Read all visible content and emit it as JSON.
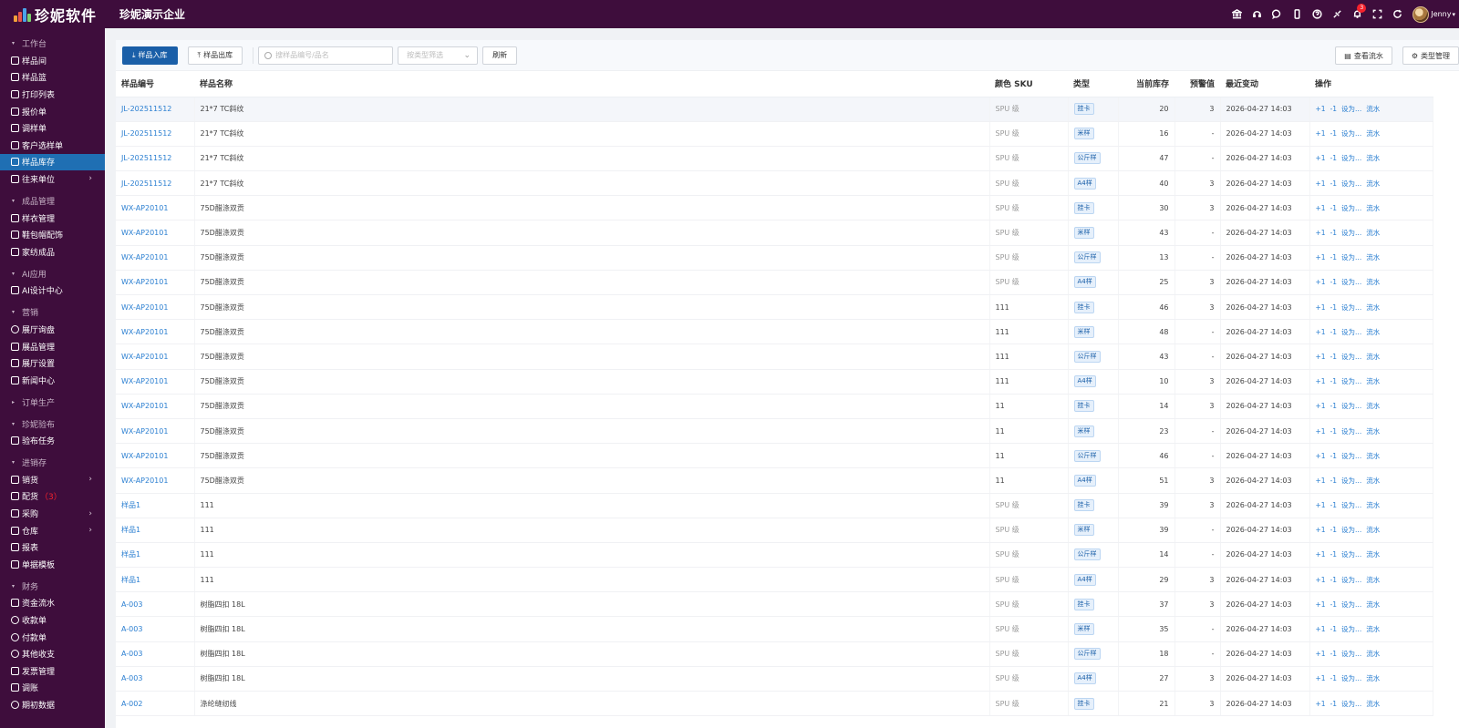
{
  "app": {
    "logo_text": "珍妮软件",
    "company": "珍妮演示企业",
    "user_name": "Jenny",
    "notify_count": "3",
    "colors": {
      "brand": "#3e0d3c",
      "primary": "#1a5fa8",
      "active": "#1f6fb3",
      "link": "#2b7fd1",
      "badge": "#f5222d"
    }
  },
  "top_icons": [
    "bank-icon",
    "headset-icon",
    "chat-icon",
    "phone-icon",
    "help-icon",
    "link-icon",
    "bell-icon",
    "fullscreen-icon",
    "refresh-icon"
  ],
  "sidebar": {
    "groups": [
      {
        "title": "工作台",
        "items": [
          {
            "label": "样品间",
            "icon": "home-icon"
          },
          {
            "label": "样品篮",
            "icon": "basket-icon"
          },
          {
            "label": "打印列表",
            "icon": "printer-icon"
          },
          {
            "label": "报价单",
            "icon": "quote-icon"
          },
          {
            "label": "调样单",
            "icon": "truck-icon"
          },
          {
            "label": "客户选样单",
            "icon": "cart-icon"
          },
          {
            "label": "样品库存",
            "icon": "inventory-icon",
            "active": true
          },
          {
            "label": "往来单位",
            "icon": "users-icon",
            "arrow": true
          }
        ]
      },
      {
        "title": "成品管理",
        "items": [
          {
            "label": "样衣管理",
            "icon": "shirt-icon"
          },
          {
            "label": "鞋包帽配饰",
            "icon": "bag-icon"
          },
          {
            "label": "家纺成品",
            "icon": "home-icon"
          }
        ]
      },
      {
        "title": "AI应用",
        "items": [
          {
            "label": "AI设计中心",
            "icon": "ai-icon"
          }
        ]
      },
      {
        "title": "营销",
        "items": [
          {
            "label": "展厅询盘",
            "icon": "chat-icon"
          },
          {
            "label": "展品管理",
            "icon": "image-icon"
          },
          {
            "label": "展厅设置",
            "icon": "settings-icon"
          },
          {
            "label": "新闻中心",
            "icon": "news-icon"
          }
        ]
      },
      {
        "title": "订单生产",
        "collapsed": true,
        "items": []
      },
      {
        "title": "珍妮验布",
        "items": [
          {
            "label": "验布任务",
            "icon": "task-icon"
          }
        ]
      },
      {
        "title": "进销存",
        "items": [
          {
            "label": "销货",
            "icon": "doc-icon",
            "arrow": true
          },
          {
            "label": "配货",
            "icon": "doc-icon",
            "badge": "（3）"
          },
          {
            "label": "采购",
            "icon": "cart-icon",
            "arrow": true
          },
          {
            "label": "仓库",
            "icon": "warehouse-icon",
            "arrow": true
          },
          {
            "label": "报表",
            "icon": "table-icon"
          },
          {
            "label": "单据模板",
            "icon": "template-icon"
          }
        ]
      },
      {
        "title": "财务",
        "items": [
          {
            "label": "资金流水",
            "icon": "money-icon"
          },
          {
            "label": "收款单",
            "icon": "coin-icon"
          },
          {
            "label": "付款单",
            "icon": "coin-icon"
          },
          {
            "label": "其他收支",
            "icon": "coin-icon"
          },
          {
            "label": "发票管理",
            "icon": "invoice-icon"
          },
          {
            "label": "调账",
            "icon": "balance-icon"
          },
          {
            "label": "期初数据",
            "icon": "clock-icon"
          }
        ]
      }
    ]
  },
  "toolbar": {
    "inbound_label": "样品入库",
    "outbound_label": "样品出库",
    "search_placeholder": "搜样品编号/品名",
    "type_filter_placeholder": "按类型筛选",
    "refresh_label": "刷新",
    "view_flow_label": "查看流水",
    "type_manage_label": "类型管理"
  },
  "table": {
    "columns": [
      "样品编号",
      "样品名称",
      "颜色 SKU",
      "类型",
      "当前库存",
      "预警值",
      "最近变动",
      "操作"
    ],
    "ops": [
      "+1",
      "-1",
      "设为...",
      "流水"
    ],
    "rows": [
      {
        "code": "JL-202511512",
        "name": "21*7 TC斜纹",
        "sku": "SPU 级",
        "type": "挂卡",
        "stock": "20",
        "warn": "3",
        "time": "2026-04-27 14:03"
      },
      {
        "code": "JL-202511512",
        "name": "21*7 TC斜纹",
        "sku": "SPU 级",
        "type": "米样",
        "stock": "16",
        "warn": "-",
        "time": "2026-04-27 14:03"
      },
      {
        "code": "JL-202511512",
        "name": "21*7 TC斜纹",
        "sku": "SPU 级",
        "type": "公斤样",
        "stock": "47",
        "warn": "-",
        "time": "2026-04-27 14:03"
      },
      {
        "code": "JL-202511512",
        "name": "21*7 TC斜纹",
        "sku": "SPU 级",
        "type": "A4样",
        "stock": "40",
        "warn": "3",
        "time": "2026-04-27 14:03"
      },
      {
        "code": "WX-AP20101",
        "name": "75D醋涤双贡",
        "sku": "SPU 级",
        "type": "挂卡",
        "stock": "30",
        "warn": "3",
        "time": "2026-04-27 14:03"
      },
      {
        "code": "WX-AP20101",
        "name": "75D醋涤双贡",
        "sku": "SPU 级",
        "type": "米样",
        "stock": "43",
        "warn": "-",
        "time": "2026-04-27 14:03"
      },
      {
        "code": "WX-AP20101",
        "name": "75D醋涤双贡",
        "sku": "SPU 级",
        "type": "公斤样",
        "stock": "13",
        "warn": "-",
        "time": "2026-04-27 14:03"
      },
      {
        "code": "WX-AP20101",
        "name": "75D醋涤双贡",
        "sku": "SPU 级",
        "type": "A4样",
        "stock": "25",
        "warn": "3",
        "time": "2026-04-27 14:03"
      },
      {
        "code": "WX-AP20101",
        "name": "75D醋涤双贡",
        "sku": "111",
        "type": "挂卡",
        "stock": "46",
        "warn": "3",
        "time": "2026-04-27 14:03"
      },
      {
        "code": "WX-AP20101",
        "name": "75D醋涤双贡",
        "sku": "111",
        "type": "米样",
        "stock": "48",
        "warn": "-",
        "time": "2026-04-27 14:03"
      },
      {
        "code": "WX-AP20101",
        "name": "75D醋涤双贡",
        "sku": "111",
        "type": "公斤样",
        "stock": "43",
        "warn": "-",
        "time": "2026-04-27 14:03"
      },
      {
        "code": "WX-AP20101",
        "name": "75D醋涤双贡",
        "sku": "111",
        "type": "A4样",
        "stock": "10",
        "warn": "3",
        "time": "2026-04-27 14:03"
      },
      {
        "code": "WX-AP20101",
        "name": "75D醋涤双贡",
        "sku": "11",
        "type": "挂卡",
        "stock": "14",
        "warn": "3",
        "time": "2026-04-27 14:03"
      },
      {
        "code": "WX-AP20101",
        "name": "75D醋涤双贡",
        "sku": "11",
        "type": "米样",
        "stock": "23",
        "warn": "-",
        "time": "2026-04-27 14:03"
      },
      {
        "code": "WX-AP20101",
        "name": "75D醋涤双贡",
        "sku": "11",
        "type": "公斤样",
        "stock": "46",
        "warn": "-",
        "time": "2026-04-27 14:03"
      },
      {
        "code": "WX-AP20101",
        "name": "75D醋涤双贡",
        "sku": "11",
        "type": "A4样",
        "stock": "51",
        "warn": "3",
        "time": "2026-04-27 14:03"
      },
      {
        "code": "样品1",
        "name": "111",
        "sku": "SPU 级",
        "type": "挂卡",
        "stock": "39",
        "warn": "3",
        "time": "2026-04-27 14:03"
      },
      {
        "code": "样品1",
        "name": "111",
        "sku": "SPU 级",
        "type": "米样",
        "stock": "39",
        "warn": "-",
        "time": "2026-04-27 14:03"
      },
      {
        "code": "样品1",
        "name": "111",
        "sku": "SPU 级",
        "type": "公斤样",
        "stock": "14",
        "warn": "-",
        "time": "2026-04-27 14:03"
      },
      {
        "code": "样品1",
        "name": "111",
        "sku": "SPU 级",
        "type": "A4样",
        "stock": "29",
        "warn": "3",
        "time": "2026-04-27 14:03"
      },
      {
        "code": "A-003",
        "name": "树脂四扣 18L",
        "sku": "SPU 级",
        "type": "挂卡",
        "stock": "37",
        "warn": "3",
        "time": "2026-04-27 14:03"
      },
      {
        "code": "A-003",
        "name": "树脂四扣 18L",
        "sku": "SPU 级",
        "type": "米样",
        "stock": "35",
        "warn": "-",
        "time": "2026-04-27 14:03"
      },
      {
        "code": "A-003",
        "name": "树脂四扣 18L",
        "sku": "SPU 级",
        "type": "公斤样",
        "stock": "18",
        "warn": "-",
        "time": "2026-04-27 14:03"
      },
      {
        "code": "A-003",
        "name": "树脂四扣 18L",
        "sku": "SPU 级",
        "type": "A4样",
        "stock": "27",
        "warn": "3",
        "time": "2026-04-27 14:03"
      },
      {
        "code": "A-002",
        "name": "涤纶缝纫线",
        "sku": "SPU 级",
        "type": "挂卡",
        "stock": "21",
        "warn": "3",
        "time": "2026-04-27 14:03"
      }
    ]
  }
}
